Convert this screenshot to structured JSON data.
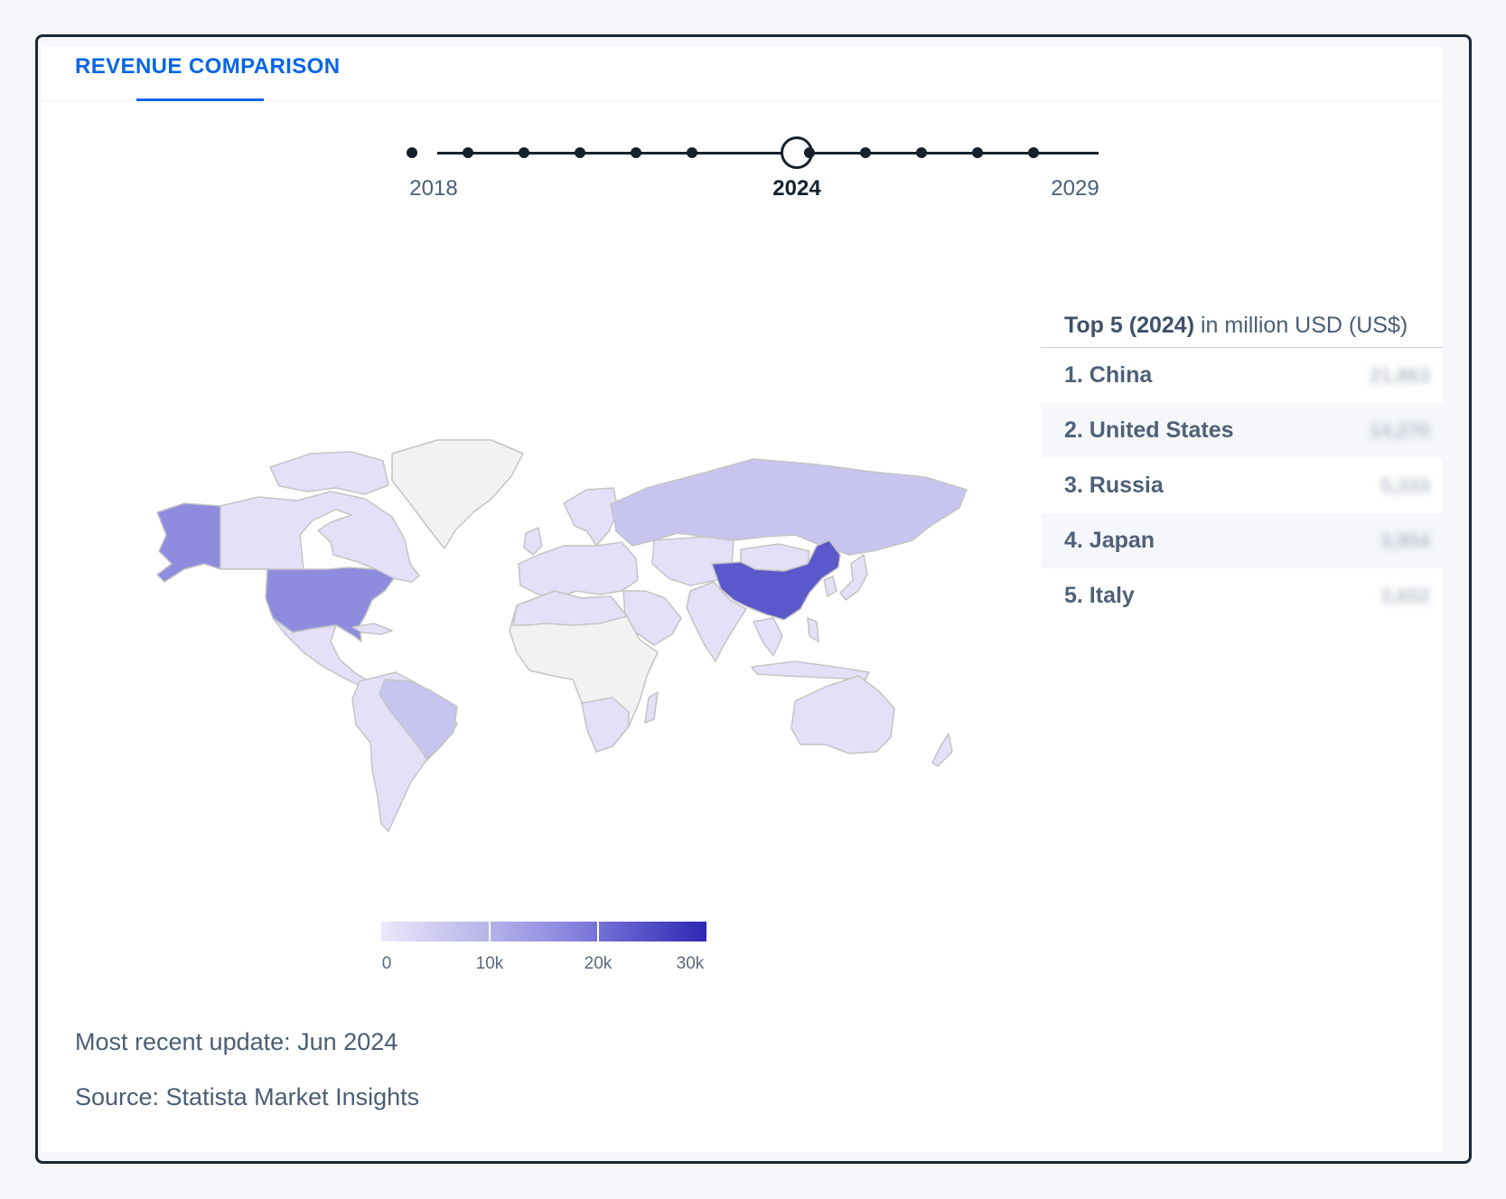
{
  "tab": {
    "label": "REVENUE COMPARISON"
  },
  "timeline": {
    "years_shown": [
      "2018",
      "2024",
      "2029"
    ],
    "selected_year": "2024"
  },
  "legend": {
    "ticks": [
      "0",
      "10k",
      "20k",
      "30k"
    ],
    "colors": [
      "#ebe8fa",
      "#b5b2e9",
      "#8f8ce0",
      "#5a58cb",
      "#2d27b3"
    ]
  },
  "top5": {
    "title_bold": "Top 5 (2024)",
    "title_rest": " in million USD (US$)",
    "rows": [
      {
        "rank_label": "1. China",
        "value": "21,863"
      },
      {
        "rank_label": "2. United States",
        "value": "14,270"
      },
      {
        "rank_label": "3. Russia",
        "value": "5,333"
      },
      {
        "rank_label": "4. Japan",
        "value": "3,954"
      },
      {
        "rank_label": "5. Italy",
        "value": "3,652"
      }
    ]
  },
  "footer": {
    "update": "Most recent update: Jun 2024",
    "source": "Source: Statista Market Insights"
  },
  "map_colors": {
    "no_data": "#f2f2f2",
    "low": "#e3e0f8",
    "russia": "#c7c4ef",
    "alaska": "#8f8ce0",
    "usa": "#8f8ce0",
    "china": "#5a58cb"
  }
}
